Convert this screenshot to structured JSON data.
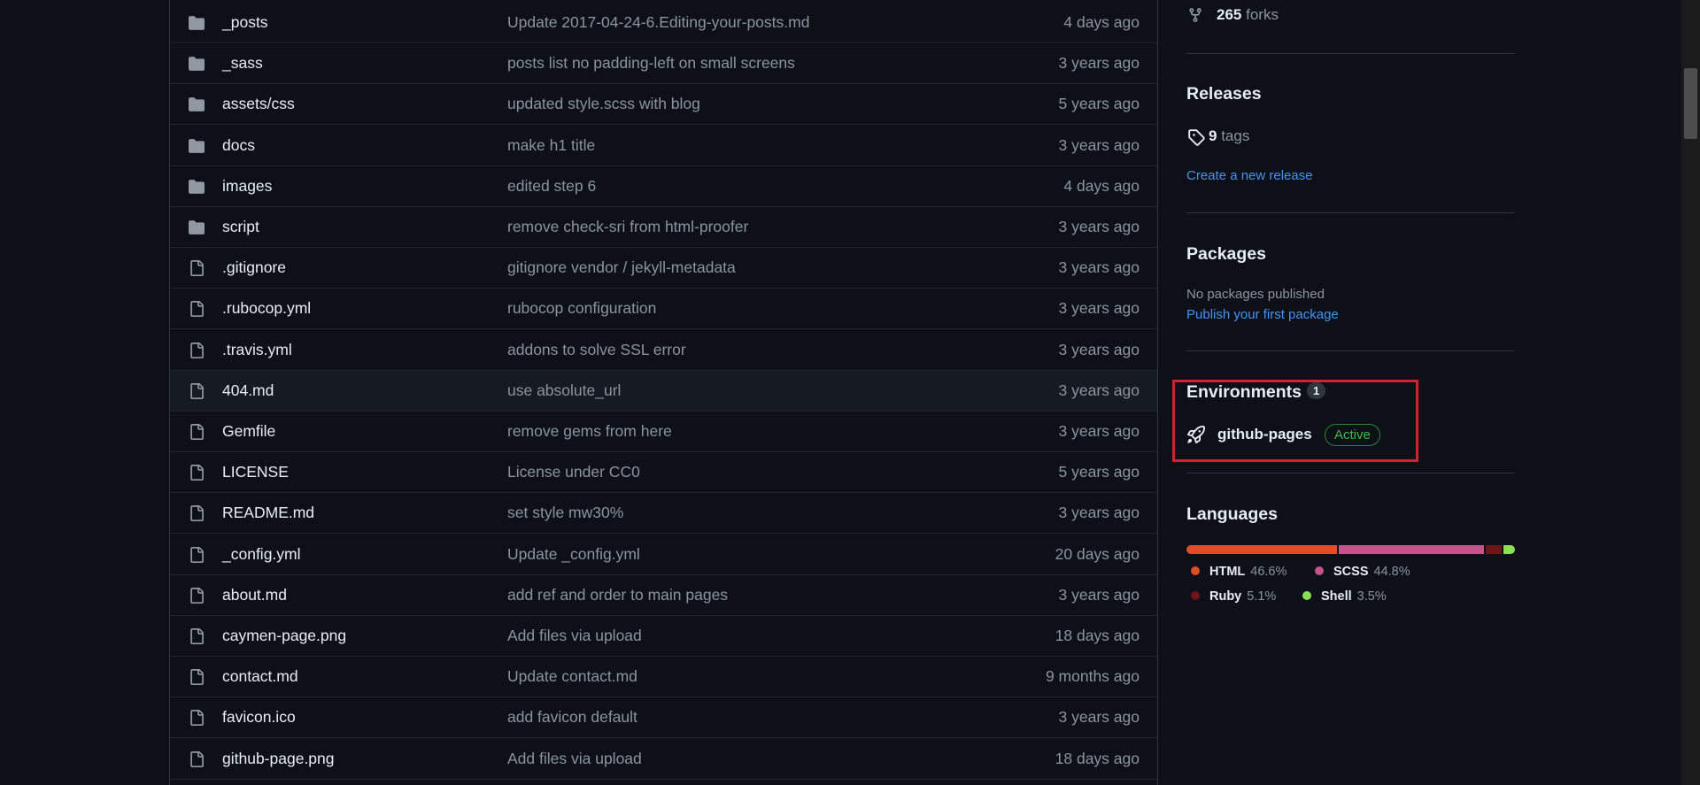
{
  "files": [
    {
      "type": "dir",
      "name": "_posts",
      "message": "Update 2017-04-24-6.Editing-your-posts.md",
      "age": "4 days ago"
    },
    {
      "type": "dir",
      "name": "_sass",
      "message": "posts list no padding-left on small screens",
      "age": "3 years ago"
    },
    {
      "type": "dir",
      "name": "assets/css",
      "message": "updated style.scss with blog",
      "age": "5 years ago"
    },
    {
      "type": "dir",
      "name": "docs",
      "message": "make h1 title",
      "age": "3 years ago"
    },
    {
      "type": "dir",
      "name": "images",
      "message": "edited step 6",
      "age": "4 days ago"
    },
    {
      "type": "dir",
      "name": "script",
      "message": "remove check-sri from html-proofer",
      "age": "3 years ago"
    },
    {
      "type": "file",
      "name": ".gitignore",
      "message": "gitignore vendor / jekyll-metadata",
      "age": "3 years ago"
    },
    {
      "type": "file",
      "name": ".rubocop.yml",
      "message": "rubocop configuration",
      "age": "3 years ago"
    },
    {
      "type": "file",
      "name": ".travis.yml",
      "message": "addons to solve SSL error",
      "age": "3 years ago"
    },
    {
      "type": "file",
      "name": "404.md",
      "message": "use absolute_url",
      "age": "3 years ago"
    },
    {
      "type": "file",
      "name": "Gemfile",
      "message": "remove gems from here",
      "age": "3 years ago"
    },
    {
      "type": "file",
      "name": "LICENSE",
      "message": "License under CC0",
      "age": "5 years ago"
    },
    {
      "type": "file",
      "name": "README.md",
      "message": "set style mw30%",
      "age": "3 years ago"
    },
    {
      "type": "file",
      "name": "_config.yml",
      "message": "Update _config.yml",
      "age": "20 days ago"
    },
    {
      "type": "file",
      "name": "about.md",
      "message": "add ref and order to main pages",
      "age": "3 years ago"
    },
    {
      "type": "file",
      "name": "caymen-page.png",
      "message": "Add files via upload",
      "age": "18 days ago"
    },
    {
      "type": "file",
      "name": "contact.md",
      "message": "Update contact.md",
      "age": "9 months ago"
    },
    {
      "type": "file",
      "name": "favicon.ico",
      "message": "add favicon default",
      "age": "3 years ago"
    },
    {
      "type": "file",
      "name": "github-page.png",
      "message": "Add files via upload",
      "age": "18 days ago"
    }
  ],
  "icons": {
    "folder": "folder-icon",
    "file": "file-icon",
    "fork": "fork-icon",
    "tag": "tag-icon",
    "rocket": "rocket-icon"
  },
  "sidebar": {
    "forks": {
      "count": "265",
      "label": "forks"
    },
    "releases": {
      "title": "Releases",
      "tags_count": "9",
      "tags_label": "tags",
      "create_link": "Create a new release"
    },
    "packages": {
      "title": "Packages",
      "empty_text": "No packages published",
      "publish_link": "Publish your first package"
    },
    "environments": {
      "title": "Environments",
      "count": "1",
      "name": "github-pages",
      "status": "Active"
    },
    "languages": {
      "title": "Languages",
      "items": [
        {
          "name": "HTML",
          "percent": "46.6%",
          "value": 46.6,
          "color": "#e34c26"
        },
        {
          "name": "SCSS",
          "percent": "44.8%",
          "value": 44.8,
          "color": "#c6538c"
        },
        {
          "name": "Ruby",
          "percent": "5.1%",
          "value": 5.1,
          "color": "#701516"
        },
        {
          "name": "Shell",
          "percent": "3.5%",
          "value": 3.5,
          "color": "#89e051"
        }
      ]
    }
  },
  "colors": {
    "highlight_box": "#d3222c",
    "active_badge": "#3fb950",
    "link": "#4493f8"
  }
}
